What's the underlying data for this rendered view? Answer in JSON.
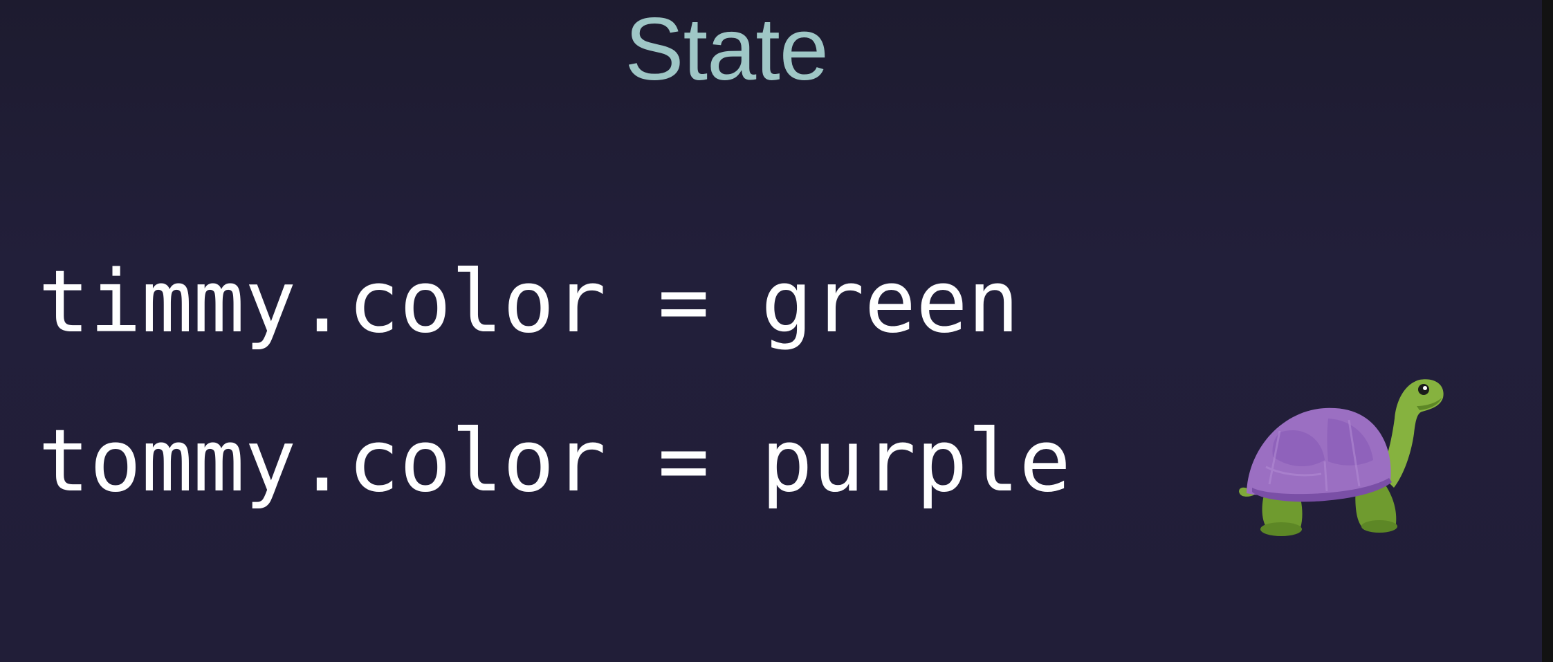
{
  "slide": {
    "title": "State",
    "lines": [
      "timmy.color = green",
      "tommy.color = purple"
    ],
    "illustration": "turtle-icon"
  },
  "colors": {
    "background": "#211e38",
    "title": "#9fc7c6",
    "text": "#ffffff",
    "turtle_shell": "#9b6fc2",
    "turtle_body": "#7fa83a"
  }
}
